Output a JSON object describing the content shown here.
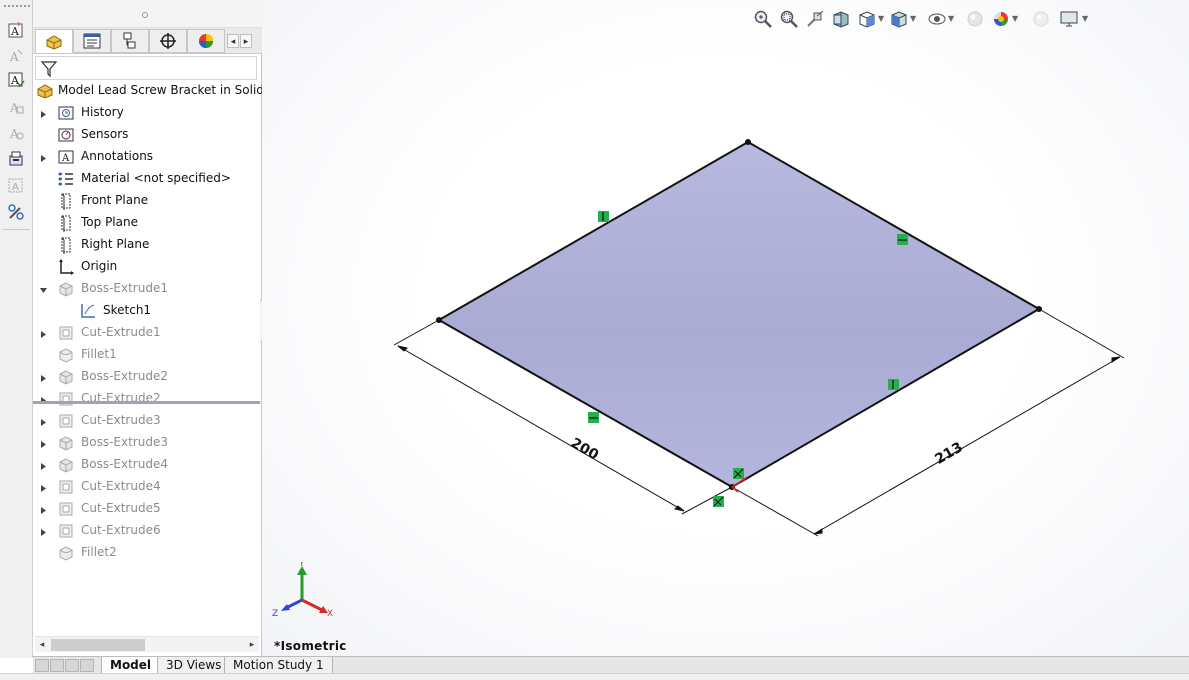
{
  "tree": {
    "root": "Model Lead Screw Bracket in SolidWor",
    "items": [
      {
        "label": "History",
        "expandable": true,
        "dim": false,
        "indent": 0,
        "icon": "history-icon"
      },
      {
        "label": "Sensors",
        "expandable": false,
        "dim": false,
        "indent": 0,
        "icon": "sensor-icon"
      },
      {
        "label": "Annotations",
        "expandable": true,
        "dim": false,
        "indent": 0,
        "icon": "annotations-icon"
      },
      {
        "label": "Material <not specified>",
        "expandable": false,
        "dim": false,
        "indent": 0,
        "icon": "material-icon"
      },
      {
        "label": "Front Plane",
        "expandable": false,
        "dim": false,
        "indent": 0,
        "icon": "plane-icon"
      },
      {
        "label": "Top Plane",
        "expandable": false,
        "dim": false,
        "indent": 0,
        "icon": "plane-icon"
      },
      {
        "label": "Right Plane",
        "expandable": false,
        "dim": false,
        "indent": 0,
        "icon": "plane-icon"
      },
      {
        "label": "Origin",
        "expandable": false,
        "dim": false,
        "indent": 0,
        "icon": "origin-icon"
      },
      {
        "label": "Boss-Extrude1",
        "expandable": true,
        "expanded": true,
        "dim": true,
        "indent": 0,
        "icon": "boss-extrude-icon"
      },
      {
        "label": "Sketch1",
        "expandable": false,
        "dim": false,
        "indent": 1,
        "icon": "sketch-icon"
      },
      {
        "label": "Cut-Extrude1",
        "expandable": true,
        "dim": true,
        "indent": 0,
        "icon": "cut-extrude-icon"
      },
      {
        "label": "Fillet1",
        "expandable": false,
        "dim": true,
        "indent": 0,
        "icon": "fillet-icon"
      },
      {
        "label": "Boss-Extrude2",
        "expandable": true,
        "dim": true,
        "indent": 0,
        "icon": "boss-extrude-icon"
      },
      {
        "label": "Cut-Extrude2",
        "expandable": true,
        "dim": true,
        "indent": 0,
        "icon": "cut-extrude-icon"
      },
      {
        "label": "Cut-Extrude3",
        "expandable": true,
        "dim": true,
        "indent": 0,
        "icon": "cut-extrude-icon"
      },
      {
        "label": "Boss-Extrude3",
        "expandable": true,
        "dim": true,
        "indent": 0,
        "icon": "boss-extrude-icon"
      },
      {
        "label": "Boss-Extrude4",
        "expandable": true,
        "dim": true,
        "indent": 0,
        "icon": "boss-extrude-icon"
      },
      {
        "label": "Cut-Extrude4",
        "expandable": true,
        "dim": true,
        "indent": 0,
        "icon": "cut-extrude-icon"
      },
      {
        "label": "Cut-Extrude5",
        "expandable": true,
        "dim": true,
        "indent": 0,
        "icon": "cut-extrude-icon"
      },
      {
        "label": "Cut-Extrude6",
        "expandable": true,
        "dim": true,
        "indent": 0,
        "icon": "cut-extrude-icon"
      },
      {
        "label": "Fillet2",
        "expandable": false,
        "dim": true,
        "indent": 0,
        "icon": "fillet-icon"
      }
    ]
  },
  "bottom_tabs": [
    {
      "label": "Model",
      "active": true
    },
    {
      "label": "3D Views",
      "active": false
    },
    {
      "label": "Motion Study 1",
      "active": false
    }
  ],
  "viewport": {
    "view_name": "*Isometric",
    "dimensions": {
      "left": "200",
      "right": "213"
    },
    "triad": {
      "x": "X",
      "y": "Y",
      "z": "Z"
    }
  },
  "colors": {
    "face_fill": "#aeb1d8",
    "edge": "#111111",
    "relation_marker": "#22b14c",
    "triad_x": "#d42a2a",
    "triad_y": "#2a9a2a",
    "triad_z": "#2a4ad4"
  }
}
